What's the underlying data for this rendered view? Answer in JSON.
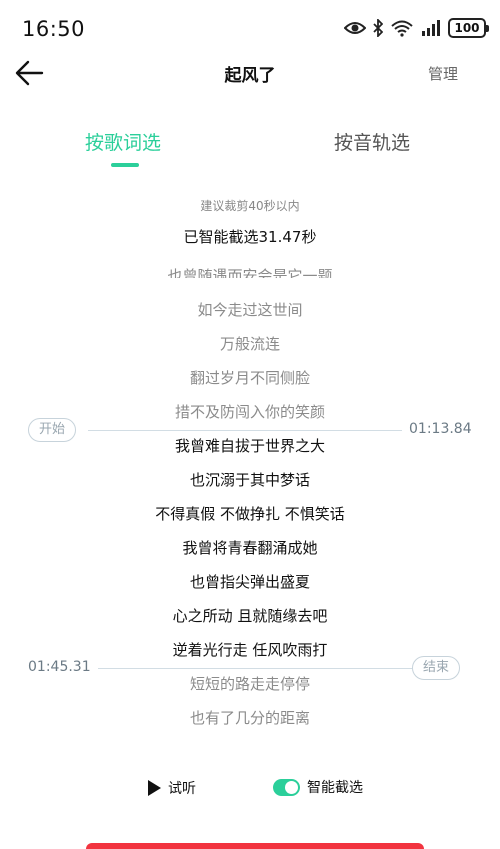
{
  "status": {
    "time": "16:50",
    "battery": "100",
    "icons": [
      "eye-icon",
      "bluetooth-icon",
      "wifi-icon",
      "signal-icon",
      "battery-icon"
    ]
  },
  "header": {
    "title": "起风了",
    "manage_label": "管理"
  },
  "tabs": {
    "lyrics_label": "按歌词选",
    "track_label": "按音轨选",
    "active": "lyrics_label",
    "accent_color": "#2bcf9a"
  },
  "hint": "建议裁剪40秒以内",
  "selected_info": "已智能截选31.47秒",
  "lyrics": {
    "lines": [
      "也曾随遇而安会是它一题",
      "如今走过这世间",
      "万般流连",
      "翻过岁月不同侧脸",
      "措不及防闯入你的笑颜",
      "我曾难自拔于世界之大",
      "也沉溺于其中梦话",
      "不得真假 不做挣扎 不惧笑话",
      "我曾将青春翻涌成她",
      "也曾指尖弹出盛夏",
      "心之所动 且就随缘去吧",
      "逆着光行走 任风吹雨打",
      "短短的路走走停停",
      "也有了几分的距离"
    ]
  },
  "markers": {
    "start_label": "开始",
    "start_time": "01:13.84",
    "end_label": "结束",
    "end_time": "01:45.31"
  },
  "controls": {
    "preview_label": "试听",
    "smart_label": "智能截选",
    "smart_enabled": true
  },
  "colors": {
    "confirm": "#f2333f"
  }
}
